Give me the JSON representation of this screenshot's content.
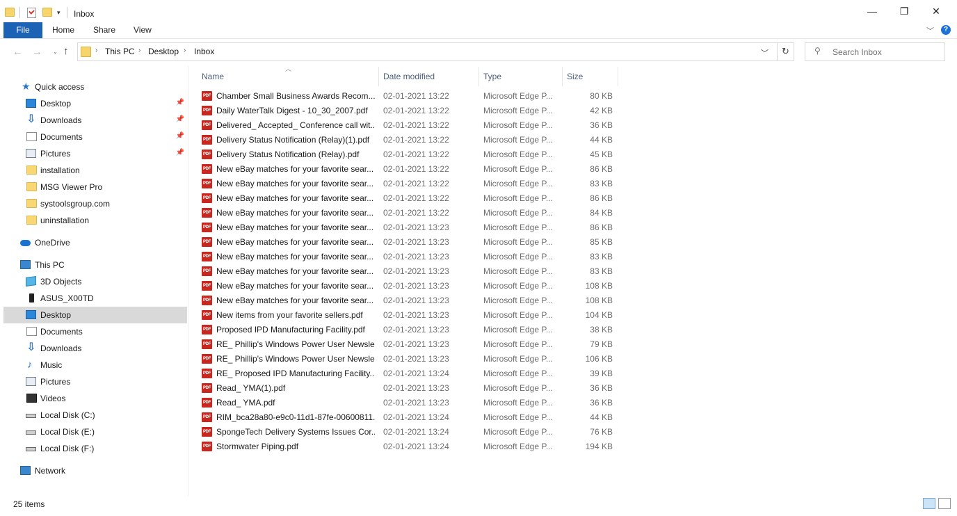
{
  "window": {
    "title": "Inbox",
    "controls": {
      "minimize": "—",
      "maximize": "❐",
      "close": "✕"
    }
  },
  "ribbon": {
    "tabs": [
      "File",
      "Home",
      "Share",
      "View"
    ],
    "help_label": "?"
  },
  "address": {
    "path": [
      "This PC",
      "Desktop",
      "Inbox"
    ],
    "search_placeholder": "Search Inbox"
  },
  "nav": {
    "quick_access": {
      "label": "Quick access",
      "items": [
        {
          "label": "Desktop",
          "icon": "desktop-icon",
          "pinned": true
        },
        {
          "label": "Downloads",
          "icon": "downloads-icon",
          "pinned": true
        },
        {
          "label": "Documents",
          "icon": "documents-icon",
          "pinned": true
        },
        {
          "label": "Pictures",
          "icon": "pictures-icon",
          "pinned": true
        },
        {
          "label": "installation",
          "icon": "folder-icon",
          "pinned": false
        },
        {
          "label": "MSG Viewer Pro",
          "icon": "folder-icon",
          "pinned": false
        },
        {
          "label": "systoolsgroup.com",
          "icon": "folder-icon",
          "pinned": false
        },
        {
          "label": "uninstallation",
          "icon": "folder-icon",
          "pinned": false
        }
      ]
    },
    "onedrive": {
      "label": "OneDrive"
    },
    "this_pc": {
      "label": "This PC",
      "items": [
        {
          "label": "3D Objects",
          "icon": "3d-objects-icon"
        },
        {
          "label": "ASUS_X00TD",
          "icon": "phone-icon"
        },
        {
          "label": "Desktop",
          "icon": "desktop-icon",
          "selected": true
        },
        {
          "label": "Documents",
          "icon": "documents-icon"
        },
        {
          "label": "Downloads",
          "icon": "downloads-icon"
        },
        {
          "label": "Music",
          "icon": "music-icon"
        },
        {
          "label": "Pictures",
          "icon": "pictures-icon"
        },
        {
          "label": "Videos",
          "icon": "videos-icon"
        },
        {
          "label": "Local Disk (C:)",
          "icon": "disk-icon"
        },
        {
          "label": "Local Disk (E:)",
          "icon": "disk-icon"
        },
        {
          "label": "Local Disk (F:)",
          "icon": "disk-icon"
        }
      ]
    },
    "network": {
      "label": "Network"
    }
  },
  "columns": {
    "name": "Name",
    "date": "Date modified",
    "type": "Type",
    "size": "Size"
  },
  "files": [
    {
      "name": "Chamber Small Business Awards Recom...",
      "date": "02-01-2021 13:22",
      "type": "Microsoft Edge P...",
      "size": "80 KB"
    },
    {
      "name": "Daily WaterTalk Digest - 10_30_2007.pdf",
      "date": "02-01-2021 13:22",
      "type": "Microsoft Edge P...",
      "size": "42 KB"
    },
    {
      "name": "Delivered_ Accepted_ Conference call wit...",
      "date": "02-01-2021 13:22",
      "type": "Microsoft Edge P...",
      "size": "36 KB"
    },
    {
      "name": "Delivery Status Notification (Relay)(1).pdf",
      "date": "02-01-2021 13:22",
      "type": "Microsoft Edge P...",
      "size": "44 KB"
    },
    {
      "name": "Delivery Status Notification (Relay).pdf",
      "date": "02-01-2021 13:22",
      "type": "Microsoft Edge P...",
      "size": "45 KB"
    },
    {
      "name": "New eBay matches for your favorite sear...",
      "date": "02-01-2021 13:22",
      "type": "Microsoft Edge P...",
      "size": "86 KB"
    },
    {
      "name": "New eBay matches for your favorite sear...",
      "date": "02-01-2021 13:22",
      "type": "Microsoft Edge P...",
      "size": "83 KB"
    },
    {
      "name": "New eBay matches for your favorite sear...",
      "date": "02-01-2021 13:22",
      "type": "Microsoft Edge P...",
      "size": "86 KB"
    },
    {
      "name": "New eBay matches for your favorite sear...",
      "date": "02-01-2021 13:22",
      "type": "Microsoft Edge P...",
      "size": "84 KB"
    },
    {
      "name": "New eBay matches for your favorite sear...",
      "date": "02-01-2021 13:23",
      "type": "Microsoft Edge P...",
      "size": "86 KB"
    },
    {
      "name": "New eBay matches for your favorite sear...",
      "date": "02-01-2021 13:23",
      "type": "Microsoft Edge P...",
      "size": "85 KB"
    },
    {
      "name": "New eBay matches for your favorite sear...",
      "date": "02-01-2021 13:23",
      "type": "Microsoft Edge P...",
      "size": "83 KB"
    },
    {
      "name": "New eBay matches for your favorite sear...",
      "date": "02-01-2021 13:23",
      "type": "Microsoft Edge P...",
      "size": "83 KB"
    },
    {
      "name": "New eBay matches for your favorite sear...",
      "date": "02-01-2021 13:23",
      "type": "Microsoft Edge P...",
      "size": "108 KB"
    },
    {
      "name": "New eBay matches for your favorite sear...",
      "date": "02-01-2021 13:23",
      "type": "Microsoft Edge P...",
      "size": "108 KB"
    },
    {
      "name": "New items from your favorite sellers.pdf",
      "date": "02-01-2021 13:23",
      "type": "Microsoft Edge P...",
      "size": "104 KB"
    },
    {
      "name": "Proposed IPD Manufacturing Facility.pdf",
      "date": "02-01-2021 13:23",
      "type": "Microsoft Edge P...",
      "size": "38 KB"
    },
    {
      "name": "RE_ Phillip's Windows Power User Newsle...",
      "date": "02-01-2021 13:23",
      "type": "Microsoft Edge P...",
      "size": "79 KB"
    },
    {
      "name": "RE_ Phillip's Windows Power User Newsle...",
      "date": "02-01-2021 13:23",
      "type": "Microsoft Edge P...",
      "size": "106 KB"
    },
    {
      "name": "RE_ Proposed IPD Manufacturing Facility....",
      "date": "02-01-2021 13:24",
      "type": "Microsoft Edge P...",
      "size": "39 KB"
    },
    {
      "name": "Read_ YMA(1).pdf",
      "date": "02-01-2021 13:23",
      "type": "Microsoft Edge P...",
      "size": "36 KB"
    },
    {
      "name": "Read_ YMA.pdf",
      "date": "02-01-2021 13:23",
      "type": "Microsoft Edge P...",
      "size": "36 KB"
    },
    {
      "name": "RIM_bca28a80-e9c0-11d1-87fe-00600811...",
      "date": "02-01-2021 13:24",
      "type": "Microsoft Edge P...",
      "size": "44 KB"
    },
    {
      "name": "SpongeTech Delivery Systems Issues Cor...",
      "date": "02-01-2021 13:24",
      "type": "Microsoft Edge P...",
      "size": "76 KB"
    },
    {
      "name": "Stormwater Piping.pdf",
      "date": "02-01-2021 13:24",
      "type": "Microsoft Edge P...",
      "size": "194 KB"
    }
  ],
  "file_icon_text": "PDF",
  "status": {
    "item_count": "25 items"
  },
  "colors": {
    "file_tab": "#1c62b5",
    "selected_row": "#d9d9d9",
    "pdf_icon": "#c8271f"
  }
}
